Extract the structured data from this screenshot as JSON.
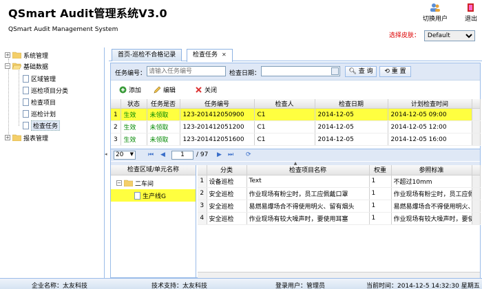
{
  "header": {
    "title": "QSmart Audit管理系统V3.0",
    "subtitle": "QSmart Audit Management System",
    "switch_user": "切换用户",
    "logout": "退出",
    "skin_label": "选择皮肤：",
    "skin_value": "Default"
  },
  "sidebar": {
    "items": [
      {
        "label": "系统管理"
      },
      {
        "label": "基础数据"
      },
      {
        "label": "区域管理"
      },
      {
        "label": "巡检项目分类"
      },
      {
        "label": "检查项目"
      },
      {
        "label": "巡检计划"
      },
      {
        "label": "检查任务"
      },
      {
        "label": "报表管理"
      }
    ]
  },
  "tabs": [
    {
      "label": "首页-巡检不合格记录"
    },
    {
      "label": "检查任务"
    }
  ],
  "search": {
    "task_no_label": "任务编号：",
    "task_no_placeholder": "请输入任务编号",
    "date_label": "检查日期：",
    "query_button": "查 询",
    "reset_button": "重 置"
  },
  "toolbar": {
    "add": "添加",
    "edit": "编辑",
    "close": "关闭"
  },
  "grid": {
    "columns": [
      "状态",
      "任务是否",
      "任务编号",
      "检查人",
      "检查日期",
      "计划检查时间"
    ],
    "rows": [
      {
        "no": "1",
        "status": "生效",
        "claimed": "未领取",
        "task_no": "123-201412050900",
        "inspector": "C1",
        "date": "2014-12-05",
        "plan": "2014-12-05 09:00"
      },
      {
        "no": "2",
        "status": "生效",
        "claimed": "未领取",
        "task_no": "123-201412051200",
        "inspector": "C1",
        "date": "2014-12-05",
        "plan": "2014-12-05 12:00"
      },
      {
        "no": "3",
        "status": "生效",
        "claimed": "未领取",
        "task_no": "123-201412051600",
        "inspector": "C1",
        "date": "2014-12-05",
        "plan": "2014-12-05 16:00"
      }
    ]
  },
  "pager": {
    "page_size": "20",
    "page": "1",
    "total": "/ 97"
  },
  "area_tree": {
    "header": "检查区域/单元名称",
    "parent": "二车间",
    "child": "生产线G"
  },
  "items_table": {
    "columns": [
      "分类",
      "检查项目名称",
      "权重",
      "参照标准"
    ],
    "rows": [
      {
        "no": "1",
        "category": "设备巡检",
        "name": "Text",
        "weight": "1",
        "standard": "不超过10mm"
      },
      {
        "no": "2",
        "category": "安全巡检",
        "name": "作业现场有粉尘时，员工应佩戴口罩",
        "weight": "1",
        "standard": "作业现场有粉尘时，员工应佩"
      },
      {
        "no": "3",
        "category": "安全巡检",
        "name": "易燃易爆场合不得使用明火、留有烟头",
        "weight": "1",
        "standard": "易燃易爆场合不得使用明火、"
      },
      {
        "no": "4",
        "category": "安全巡检",
        "name": "作业现场有较大噪声时，要使用耳塞",
        "weight": "1",
        "standard": "作业现场有较大噪声时，要使"
      }
    ]
  },
  "footer": {
    "company": "企业名称：太友科技",
    "support": "技术支持：太友科技",
    "user": "登录用户：管理员",
    "time": "当前时间：2014-12-5 14:32:30 星期五"
  }
}
